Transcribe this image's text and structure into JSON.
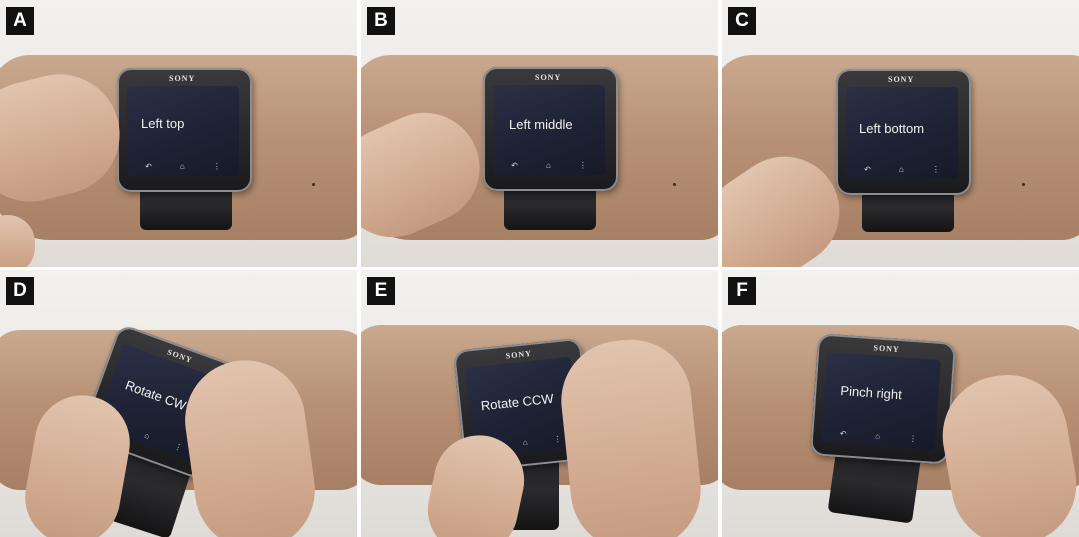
{
  "panels": [
    {
      "label": "A",
      "brand": "SONY",
      "screen_text": "Left top",
      "nav": [
        "↶",
        "⌂",
        "⋮"
      ]
    },
    {
      "label": "B",
      "brand": "SONY",
      "screen_text": "Left middle",
      "nav": [
        "↶",
        "⌂",
        "⋮"
      ]
    },
    {
      "label": "C",
      "brand": "SONY",
      "screen_text": "Left bottom",
      "nav": [
        "↶",
        "⌂",
        "⋮"
      ]
    },
    {
      "label": "D",
      "brand": "SONY",
      "screen_text": "Rotate CW",
      "nav": [
        "↶",
        "⌂",
        "⋮"
      ]
    },
    {
      "label": "E",
      "brand": "SONY",
      "screen_text": "Rotate CCW",
      "nav": [
        "↶",
        "⌂",
        "⋮"
      ]
    },
    {
      "label": "F",
      "brand": "SONY",
      "screen_text": "Pinch right",
      "nav": [
        "↶",
        "⌂",
        "⋮"
      ]
    }
  ],
  "colors": {
    "label_bg": "#111111",
    "screen": "#1d2133",
    "skin": "#b89176",
    "strap": "#1e1e20"
  }
}
